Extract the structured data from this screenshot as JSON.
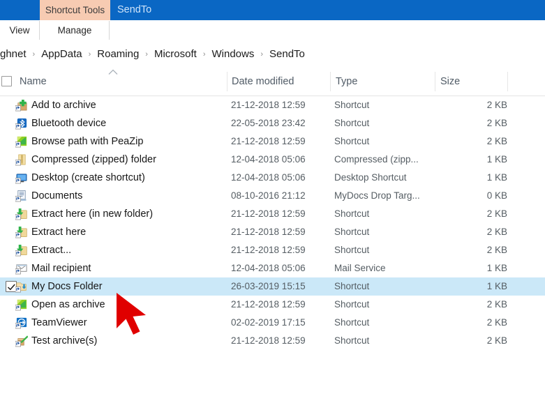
{
  "window": {
    "contextual_tab": "Shortcut Tools",
    "title": "SendTo",
    "titlebar_color": "#0a67c4",
    "contextual_tab_color": "#f7cbb2",
    "selection_color": "#cbe8f8"
  },
  "ribbon": {
    "tabs": [
      {
        "label": "View"
      },
      {
        "label": "Manage"
      }
    ]
  },
  "breadcrumb": {
    "items": [
      "ghnet",
      "AppData",
      "Roaming",
      "Microsoft",
      "Windows",
      "SendTo"
    ],
    "separator": "›"
  },
  "columns": {
    "name": "Name",
    "date_modified": "Date modified",
    "type": "Type",
    "size": "Size",
    "sort": {
      "column": "Name",
      "direction": "ascending"
    }
  },
  "files": [
    {
      "name": "Add to archive",
      "date": "21-12-2018 12:59",
      "type": "Shortcut",
      "size": "2 KB",
      "icon": "add-to-archive-icon",
      "selected": false
    },
    {
      "name": "Bluetooth device",
      "date": "22-05-2018 23:42",
      "type": "Shortcut",
      "size": "2 KB",
      "icon": "bluetooth-icon",
      "selected": false
    },
    {
      "name": "Browse path with PeaZip",
      "date": "21-12-2018 12:59",
      "type": "Shortcut",
      "size": "2 KB",
      "icon": "peazip-browse-icon",
      "selected": false
    },
    {
      "name": "Compressed (zipped) folder",
      "date": "12-04-2018 05:06",
      "type": "Compressed (zipp...",
      "size": "1 KB",
      "icon": "zipped-folder-icon",
      "selected": false
    },
    {
      "name": "Desktop (create shortcut)",
      "date": "12-04-2018 05:06",
      "type": "Desktop Shortcut",
      "size": "1 KB",
      "icon": "desktop-icon",
      "selected": false
    },
    {
      "name": "Documents",
      "date": "08-10-2016 21:12",
      "type": "MyDocs Drop Targ...",
      "size": "0 KB",
      "icon": "documents-icon",
      "selected": false
    },
    {
      "name": "Extract here (in new folder)",
      "date": "21-12-2018 12:59",
      "type": "Shortcut",
      "size": "2 KB",
      "icon": "extract-folder-icon",
      "selected": false
    },
    {
      "name": "Extract here",
      "date": "21-12-2018 12:59",
      "type": "Shortcut",
      "size": "2 KB",
      "icon": "extract-folder-icon",
      "selected": false
    },
    {
      "name": "Extract...",
      "date": "21-12-2018 12:59",
      "type": "Shortcut",
      "size": "2 KB",
      "icon": "extract-folder-icon",
      "selected": false
    },
    {
      "name": "Mail recipient",
      "date": "12-04-2018 05:06",
      "type": "Mail Service",
      "size": "1 KB",
      "icon": "mail-icon",
      "selected": false
    },
    {
      "name": "My Docs Folder",
      "date": "26-03-2019 15:15",
      "type": "Shortcut",
      "size": "1 KB",
      "icon": "my-docs-folder-icon",
      "selected": true
    },
    {
      "name": "Open as archive",
      "date": "21-12-2018 12:59",
      "type": "Shortcut",
      "size": "2 KB",
      "icon": "peazip-browse-icon",
      "selected": false
    },
    {
      "name": "TeamViewer",
      "date": "02-02-2019 17:15",
      "type": "Shortcut",
      "size": "2 KB",
      "icon": "teamviewer-icon",
      "selected": false
    },
    {
      "name": "Test archive(s)",
      "date": "21-12-2018 12:59",
      "type": "Shortcut",
      "size": "2 KB",
      "icon": "test-archive-icon",
      "selected": false
    }
  ],
  "cursor": {
    "type": "arrow-pointer",
    "color": "#e00000"
  }
}
